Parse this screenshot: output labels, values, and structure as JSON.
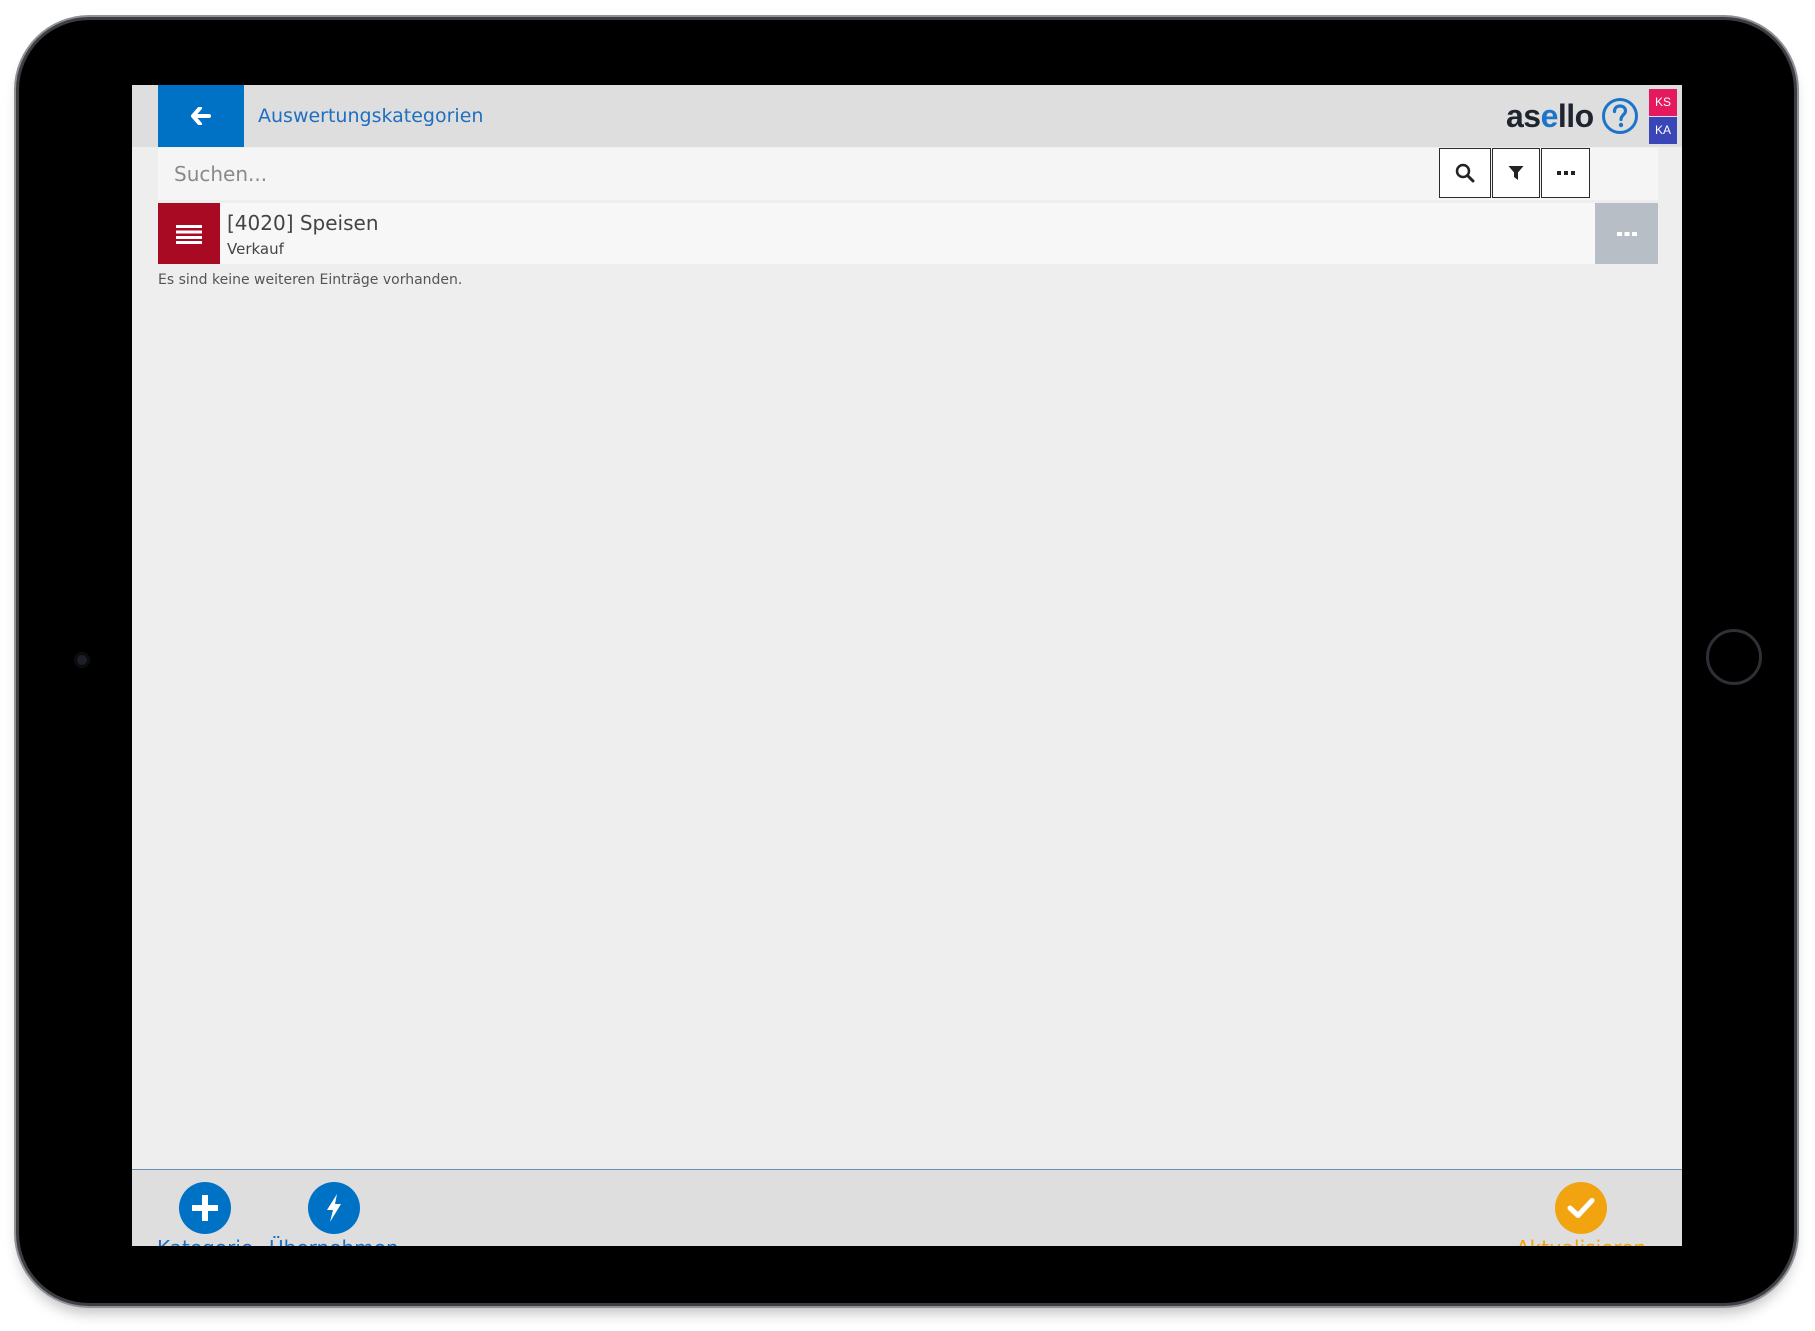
{
  "header": {
    "title": "Auswertungskategorien",
    "logo_prefix": "as",
    "logo_accent": "e",
    "logo_suffix": "llo",
    "badges": [
      "KS",
      "KA"
    ],
    "badge_colors": [
      "#e5195e",
      "#3a46b8"
    ],
    "accent_color": "#0072c6"
  },
  "search": {
    "placeholder": "Suchen...",
    "value": ""
  },
  "items": [
    {
      "title": "[4020] Speisen",
      "subtitle": "Verkauf",
      "icon": "list-icon",
      "icon_color": "#a80a24"
    }
  ],
  "empty_note": "Es sind keine weiteren Einträge vorhanden.",
  "footer": {
    "add_label": "Kategorie",
    "import_label": "Übernehmen",
    "refresh_label": "Aktualisieren",
    "refresh_color": "#f2a410"
  }
}
